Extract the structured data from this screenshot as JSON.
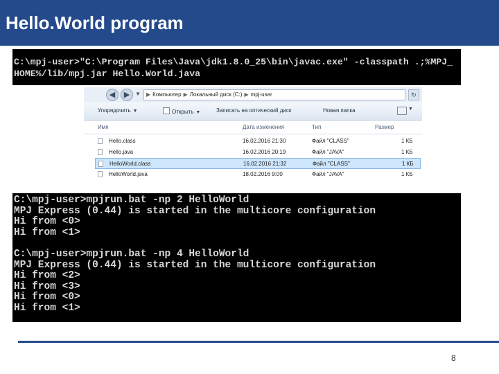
{
  "slide": {
    "title": "Hello.World program",
    "page_number": "8",
    "accent_color": "#244a8c"
  },
  "console_top": {
    "lines": [
      "C:\\mpj-user>\"C:\\Program Files\\Java\\jdk1.8.0_25\\bin\\javac.exe\" -classpath .;%MPJ_",
      "HOME%/lib/mpj.jar Hello.World.java"
    ]
  },
  "explorer": {
    "nav_back_icon": "back-arrow-icon",
    "nav_forward_icon": "forward-arrow-icon",
    "address_crumbs": [
      "Компьютер",
      "Локальный диск (C:)",
      "mpj-user"
    ],
    "toolbar": {
      "organize": "Упорядочить",
      "open": "Открыть",
      "burn": "Записать на оптический диск",
      "new_folder": "Новая папка"
    },
    "columns": {
      "name": "Имя",
      "date": "Дата изменения",
      "type": "Тип",
      "size": "Размер"
    },
    "files": [
      {
        "name": "Hello.class",
        "date": "16.02.2016 21:30",
        "type": "Файл \"CLASS\"",
        "size": "1 КБ",
        "selected": false
      },
      {
        "name": "Hello.java",
        "date": "16.02.2016 20:19",
        "type": "Файл \"JAVA\"",
        "size": "1 КБ",
        "selected": false
      },
      {
        "name": "HelloWorld.class",
        "date": "16.02.2016 21:32",
        "type": "Файл \"CLASS\"",
        "size": "1 КБ",
        "selected": true
      },
      {
        "name": "HelloWorld.java",
        "date": "18.02.2016 9:00",
        "type": "Файл \"JAVA\"",
        "size": "1 КБ",
        "selected": false
      }
    ]
  },
  "console_bottom": {
    "lines": [
      "C:\\mpj-user>mpjrun.bat -np 2 HelloWorld",
      "MPJ Express (0.44) is started in the multicore configuration",
      "Hi from <0>",
      "Hi from <1>",
      "",
      "C:\\mpj-user>mpjrun.bat -np 4 HelloWorld",
      "MPJ Express (0.44) is started in the multicore configuration",
      "Hi from <2>",
      "Hi from <3>",
      "Hi from <0>",
      "Hi from <1>"
    ]
  }
}
